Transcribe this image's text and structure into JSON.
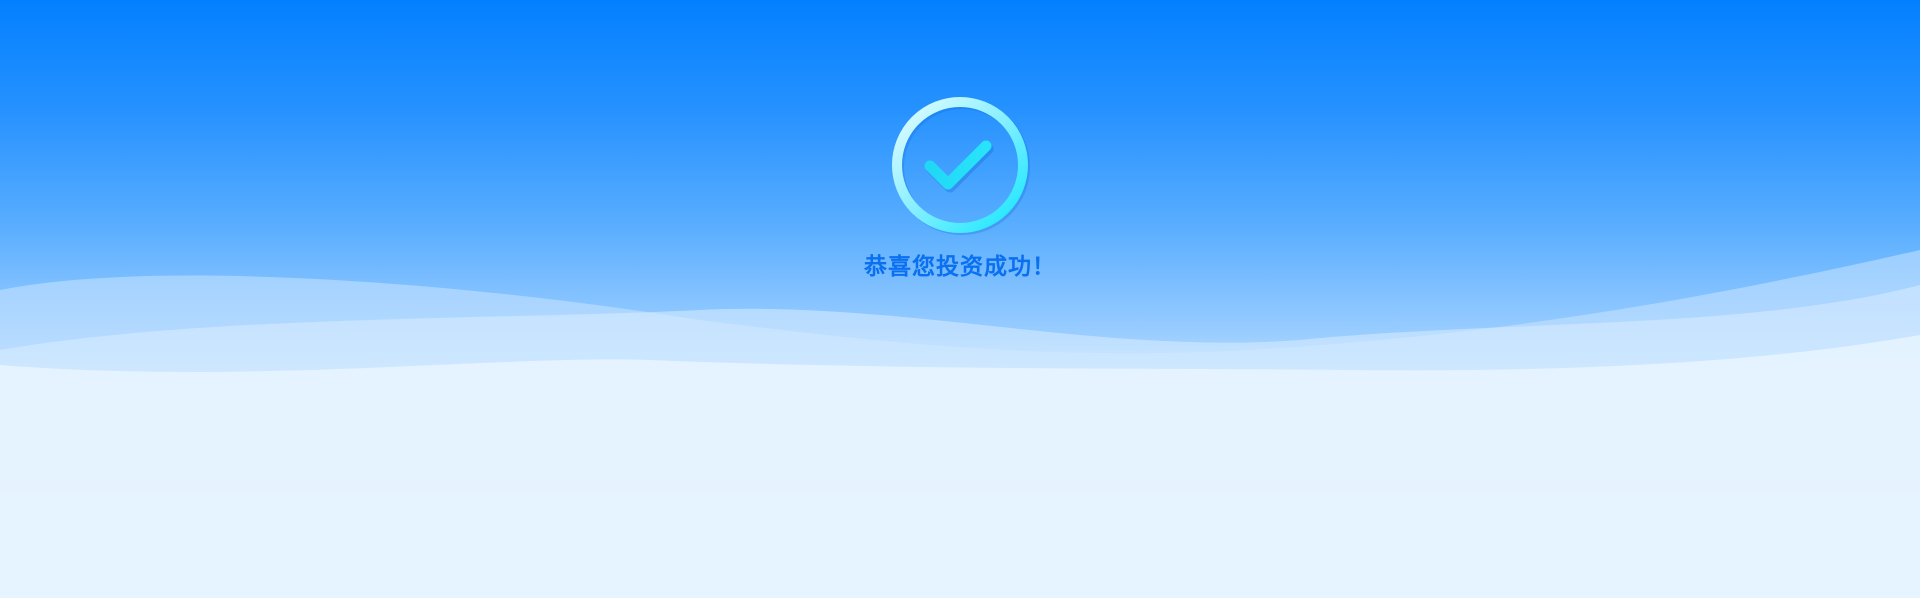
{
  "banner": {
    "message": "恭喜您投资成功！",
    "message_color": "#0a6ff0",
    "icon": "check-circle-icon",
    "colors": {
      "sky_top": "#0380ff",
      "sky_bottom": "#fbfeff",
      "ring_light": "#dcfbff",
      "ring_cyan": "#12e6ff",
      "check_color": "#22dcf4"
    }
  }
}
